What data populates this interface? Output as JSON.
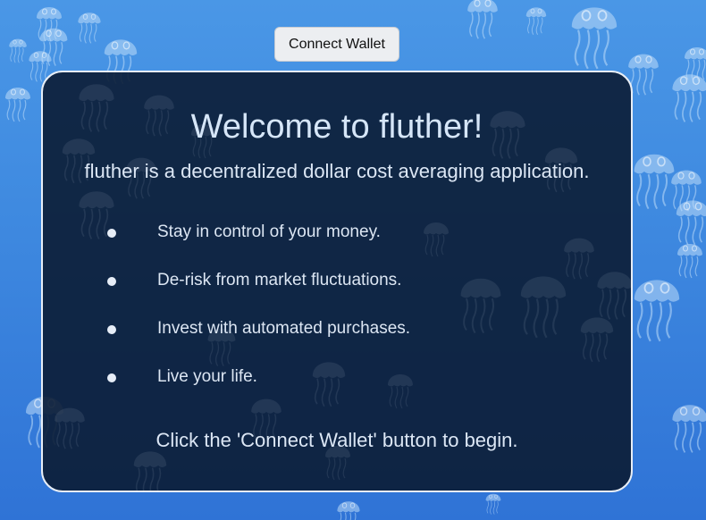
{
  "header": {
    "connect_wallet_label": "Connect Wallet"
  },
  "welcome": {
    "title": "Welcome to fluther!",
    "subtitle": "fluther is a decentralized dollar cost averaging application.",
    "features": [
      "Stay in control of your money.",
      "De-risk from market fluctuations.",
      "Invest with automated purchases.",
      "Live your life."
    ],
    "cta": "Click the 'Connect Wallet' button to begin."
  },
  "theme": {
    "background_top": "#4a97e6",
    "background_bottom": "#2f73d6",
    "card_background": "#0b1c34",
    "card_border": "#e8eef6",
    "text": "#dce7f5",
    "button_background": "#eceef1"
  },
  "background_icon": "jellyfish-icon"
}
